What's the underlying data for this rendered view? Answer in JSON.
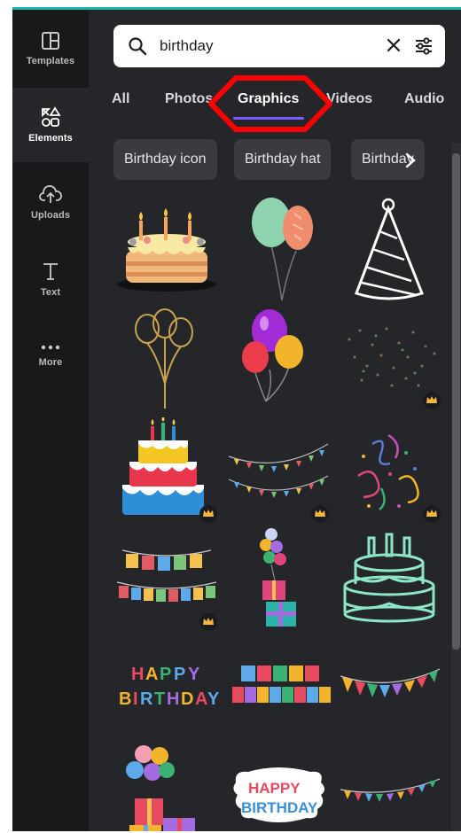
{
  "rail": {
    "items": [
      {
        "label": "Templates",
        "icon": "templates-icon"
      },
      {
        "label": "Elements",
        "icon": "elements-icon"
      },
      {
        "label": "Uploads",
        "icon": "upload-cloud-icon"
      },
      {
        "label": "Text",
        "icon": "text-icon"
      },
      {
        "label": "More",
        "icon": "more-dots-icon"
      }
    ],
    "active": "Elements"
  },
  "search": {
    "value": "birthday",
    "search_icon": "search-icon",
    "clear_icon": "close-icon",
    "filter_icon": "filter-sliders-icon"
  },
  "tabs": [
    {
      "label": "All"
    },
    {
      "label": "Photos"
    },
    {
      "label": "Graphics"
    },
    {
      "label": "Videos"
    },
    {
      "label": "Audio"
    }
  ],
  "active_tab": "Graphics",
  "chips": [
    {
      "label": "Birthday icon"
    },
    {
      "label": "Birthday hat"
    },
    {
      "label": "Birthday"
    }
  ],
  "results": [
    {
      "name": "birthday-cake-candles-graphic",
      "premium": false
    },
    {
      "name": "balloons-pair-graphic",
      "premium": false
    },
    {
      "name": "party-hat-graphic",
      "premium": false
    },
    {
      "name": "gold-balloons-outline-graphic",
      "premium": false
    },
    {
      "name": "colorful-balloons-graphic",
      "premium": false
    },
    {
      "name": "confetti-sparkles-graphic",
      "premium": true
    },
    {
      "name": "layered-birthday-cake-graphic",
      "premium": true
    },
    {
      "name": "bunting-garland-graphic",
      "premium": true
    },
    {
      "name": "streamers-confetti-graphic",
      "premium": true
    },
    {
      "name": "happy-birthday-banner-graphic",
      "premium": true
    },
    {
      "name": "balloons-gift-boxes-graphic",
      "premium": false
    },
    {
      "name": "neon-cake-outline-graphic",
      "premium": false
    },
    {
      "name": "happy-birthday-lettering-graphic",
      "premium": false
    },
    {
      "name": "happy-birthday-tiles-graphic",
      "premium": false
    },
    {
      "name": "pennant-flags-graphic",
      "premium": false
    },
    {
      "name": "balloons-presents-graphic",
      "premium": true
    },
    {
      "name": "happy-birthday-badge-graphic",
      "premium": true
    },
    {
      "name": "triangle-bunting-graphic",
      "premium": true
    }
  ],
  "colors": {
    "accent": "#7c5cff",
    "annotation": "#ff0000",
    "panel": "#25262a",
    "rail": "#18191b"
  }
}
